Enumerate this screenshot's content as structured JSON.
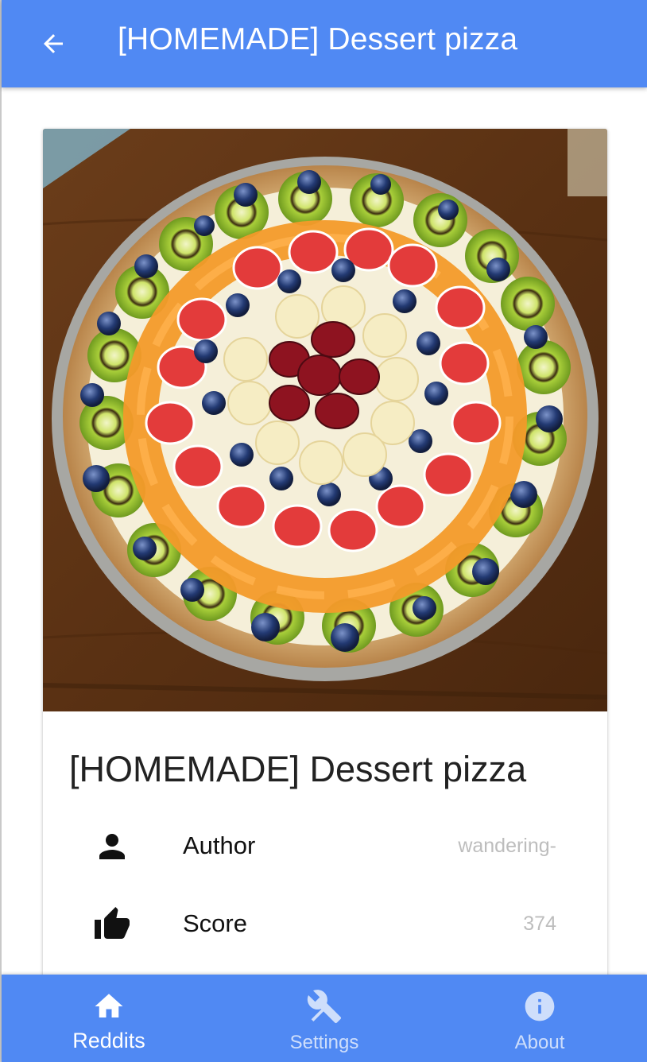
{
  "app_bar": {
    "title": "[HOMEMADE] Dessert pizza",
    "back_icon": "arrow-back-icon",
    "background": "#5089f3"
  },
  "post": {
    "image_alt": "Fruit dessert pizza topped with kiwi, blueberries, peaches, strawberries, bananas and cherries",
    "title": "[HOMEMADE] Dessert pizza",
    "details": [
      {
        "icon": "person-icon",
        "label": "Author",
        "value": "wandering-"
      },
      {
        "icon": "thumb-up-icon",
        "label": "Score",
        "value": "374"
      }
    ]
  },
  "bottom_nav": {
    "items": [
      {
        "icon": "home-icon",
        "label": "Reddits",
        "active": true
      },
      {
        "icon": "build-tools-icon",
        "label": "Settings",
        "active": false
      },
      {
        "icon": "info-icon",
        "label": "About",
        "active": false
      }
    ],
    "background": "#5089f3"
  }
}
